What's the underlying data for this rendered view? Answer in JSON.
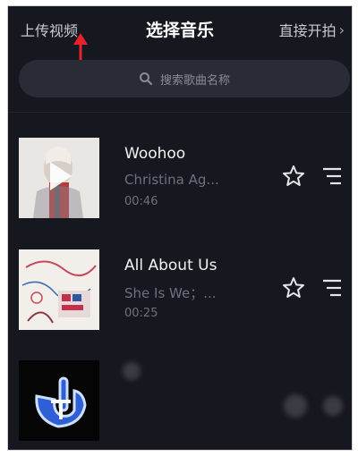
{
  "header": {
    "upload_label": "上传视频",
    "title": "选择音乐",
    "shoot_label": "直接开拍"
  },
  "search": {
    "placeholder": "搜索歌曲名称"
  },
  "songs": [
    {
      "title": "Woohoo",
      "artist": "Christina Ag...",
      "duration": "00:46"
    },
    {
      "title": "All About Us",
      "artist": "She Is We；...",
      "duration": "00:25"
    }
  ],
  "colors": {
    "background": "#16181f",
    "annotation_arrow": "#e8212b"
  },
  "icons": {
    "search": "search-icon",
    "favorite": "star-icon",
    "more": "menu-icon",
    "play": "play-icon",
    "next": "chevron-right-icon"
  }
}
